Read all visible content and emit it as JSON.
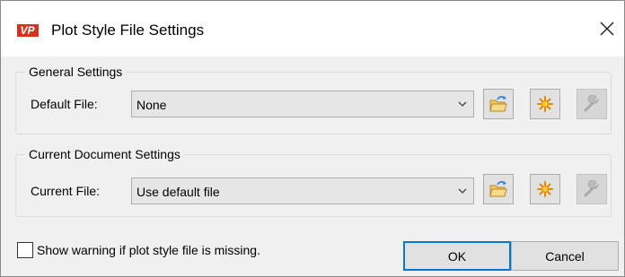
{
  "window": {
    "app_icon_text": "VP",
    "title": "Plot Style File Settings",
    "close_glyph": "×"
  },
  "general": {
    "group_label": "General Settings",
    "field_label": "Default File:",
    "combo_value": "None"
  },
  "current": {
    "group_label": "Current Document Settings",
    "field_label": "Current File:",
    "combo_value": "Use default file"
  },
  "tool_buttons": {
    "browse_icon": "folder-open-icon",
    "new_icon": "new-sparkle-icon",
    "edit_icon": "wrench-icon",
    "edit_disabled": true
  },
  "options": {
    "show_warning_label": "Show warning if plot style file is missing.",
    "show_warning_checked": false
  },
  "buttons": {
    "ok_label": "OK",
    "cancel_label": "Cancel"
  },
  "colors": {
    "accent": "#0078d7",
    "app_icon_bg": "#d7321e"
  }
}
